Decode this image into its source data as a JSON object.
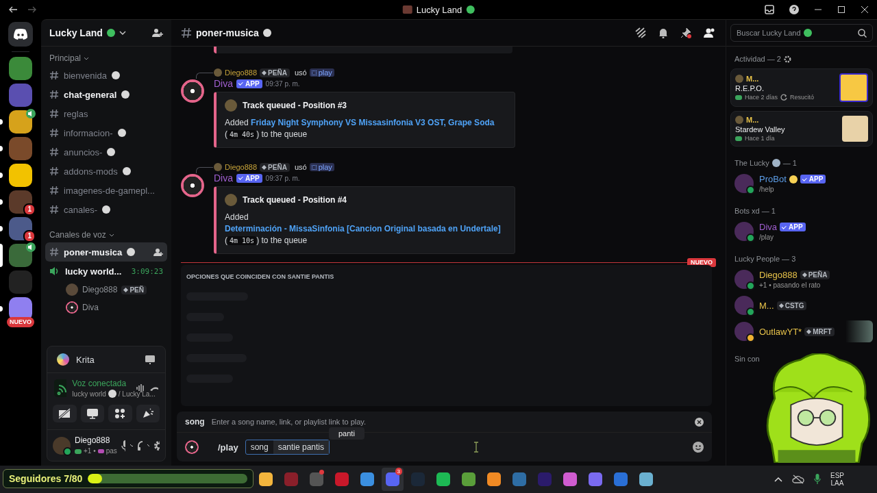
{
  "title_bar": {
    "title": "Lucky Land"
  },
  "servers": [
    {
      "unread": false,
      "selected": false,
      "voice": false
    },
    {
      "unread": false,
      "selected": false,
      "voice": false
    },
    {
      "unread": true,
      "selected": false,
      "voice": true
    },
    {
      "unread": true,
      "selected": false,
      "voice": false
    },
    {
      "unread": true,
      "selected": false,
      "voice": false
    },
    {
      "unread": true,
      "selected": false,
      "voice": false,
      "badge": "1"
    },
    {
      "unread": true,
      "selected": false,
      "voice": false,
      "badge": "1"
    },
    {
      "unread": false,
      "selected": true,
      "voice": true
    },
    {
      "unread": false,
      "selected": false,
      "voice": false
    },
    {
      "unread": true,
      "selected": false,
      "voice": false,
      "label": "NUEVO"
    }
  ],
  "server_header": {
    "name": "Lucky Land"
  },
  "channel_groups": [
    {
      "name": "Principal",
      "channels": [
        {
          "kind": "text",
          "name": "bienvenida",
          "emoji": true,
          "unread": false,
          "selected": false
        },
        {
          "kind": "text",
          "name": "chat-general",
          "emoji": true,
          "unread": true,
          "selected": false
        },
        {
          "kind": "text",
          "name": "reglas",
          "emoji": false,
          "unread": false,
          "selected": false
        },
        {
          "kind": "text",
          "name": "informacion-",
          "emoji": true,
          "unread": false,
          "selected": false
        },
        {
          "kind": "text",
          "name": "anuncios-",
          "emoji": true,
          "unread": false,
          "selected": false
        },
        {
          "kind": "text",
          "name": "addons-mods",
          "emoji": true,
          "unread": false,
          "selected": false
        },
        {
          "kind": "text",
          "name": "imagenes-de-gamepl...",
          "emoji": false,
          "unread": false,
          "selected": false
        },
        {
          "kind": "text",
          "name": "canales-",
          "emoji": true,
          "unread": false,
          "selected": false
        }
      ]
    },
    {
      "name": "Canales de voz",
      "channels": [
        {
          "kind": "text",
          "name": "poner-musica",
          "emoji": true,
          "unread": true,
          "selected": true
        },
        {
          "kind": "voice",
          "name": "lucky world...",
          "emoji": false,
          "timer": "3:09:23",
          "unread": true,
          "selected": false,
          "members": [
            {
              "name": "Diego888",
              "tag": "PEÑ"
            },
            {
              "name": "Diva"
            }
          ]
        }
      ]
    }
  ],
  "user_panel": {
    "activity": "Krita",
    "voice_status": "Voz conectada",
    "voice_channel": "lucky world",
    "voice_server": "/ Lucky La...",
    "user": "Diego888",
    "user_status": "+1 •",
    "user_status_text": "pas"
  },
  "followers": {
    "label": "Seguidores 7/80",
    "level": 0.09
  },
  "channel_header": {
    "name": "poner-musica"
  },
  "messages": [
    {
      "reply_user": "Diego888",
      "reply_tag": "PEÑA",
      "reply_verb": "usó",
      "reply_command": "play",
      "author": "Diva",
      "badge": "APP",
      "time": "09:37 p. m.",
      "embed_title": "Track queued - Position #3",
      "body": [
        {
          "kind": "text",
          "text": "Added "
        },
        {
          "kind": "link",
          "text": "Friday Night Symphony VS Missasinfonia V3 OST, Grape Soda"
        },
        {
          "kind": "text",
          "text": " ("
        },
        {
          "kind": "code",
          "text": "4m 40s"
        },
        {
          "kind": "text",
          "text": ") to the queue"
        }
      ]
    },
    {
      "reply_user": "Diego888",
      "reply_tag": "PEÑA",
      "reply_verb": "usó",
      "reply_command": "play",
      "author": "Diva",
      "badge": "APP",
      "time": "09:37 p. m.",
      "embed_title": "Track queued - Position #4",
      "body": [
        {
          "kind": "text",
          "text": "Added "
        },
        {
          "kind": "link",
          "text": "Determinación - MissaSinfonia [Cancion Original basada en Undertale]"
        },
        {
          "kind": "text",
          "text": " ("
        },
        {
          "kind": "code",
          "text": "4m 10s"
        },
        {
          "kind": "text",
          "text": ") to the queue"
        }
      ]
    }
  ],
  "new_divider": "NUEVO",
  "autocomplete": {
    "header": "OPCIONES QUE COINCIDEN CON SANTIE PANTIS"
  },
  "option_hint": {
    "name": "song",
    "description": "Enter a song name, link, or playlist link to play."
  },
  "tooltip": "panti",
  "composer": {
    "command": "/play",
    "option": "song",
    "value": "santie pantis"
  },
  "members": {
    "search_placeholder": "Buscar Lucky Land",
    "activity_header": "Actividad — 2",
    "activities": [
      {
        "user": "M...",
        "game": "R.E.P.O.",
        "time": "Hace 2 días",
        "extra": "Resucitó"
      },
      {
        "user": "M...",
        "game": "Stardew Valley",
        "time": "Hace 1 día"
      }
    ],
    "groups": [
      {
        "name": "The Lucky",
        "emoji": true,
        "count": "— 1",
        "members": [
          {
            "name": "ProBot",
            "emoji": true,
            "color": "#5d9ee8",
            "badge": "APP",
            "idle": false,
            "subtitle": "/help"
          }
        ]
      },
      {
        "name": "Bots xd — 1",
        "emoji": false,
        "members": [
          {
            "name": "Diva",
            "emoji": false,
            "color": "#a05fd0",
            "badge": "APP",
            "idle": false,
            "subtitle": "/play"
          }
        ]
      },
      {
        "name": "Lucky People — 3",
        "emoji": false,
        "members": [
          {
            "name": "Diego888",
            "emoji": false,
            "color": "#e8c34a",
            "tag": "PEÑA",
            "idle": false,
            "subtitle": "+1 • pasando el rato"
          },
          {
            "name": "M...",
            "emoji": false,
            "color": "#e8c34a",
            "tag": "CSTG",
            "idle": false
          },
          {
            "name": "OutlawYT*",
            "emoji": false,
            "color": "#e8c34a",
            "tag": "MRFT",
            "idle": true,
            "banner": true
          }
        ]
      },
      {
        "name": "Sin con",
        "emoji": false
      }
    ]
  },
  "taskbar": {
    "apps": [
      {
        "active": false
      },
      {
        "active": false
      },
      {
        "active": false,
        "badge_dot": true
      },
      {
        "active": false
      },
      {
        "active": false
      },
      {
        "active": true,
        "badge": "3"
      },
      {
        "active": false
      },
      {
        "active": false
      },
      {
        "active": false
      },
      {
        "active": false
      },
      {
        "active": false
      },
      {
        "active": false
      },
      {
        "active": false
      },
      {
        "active": false
      },
      {
        "active": false
      },
      {
        "active": false
      }
    ],
    "lang": "ESP",
    "layout": "LAA"
  }
}
